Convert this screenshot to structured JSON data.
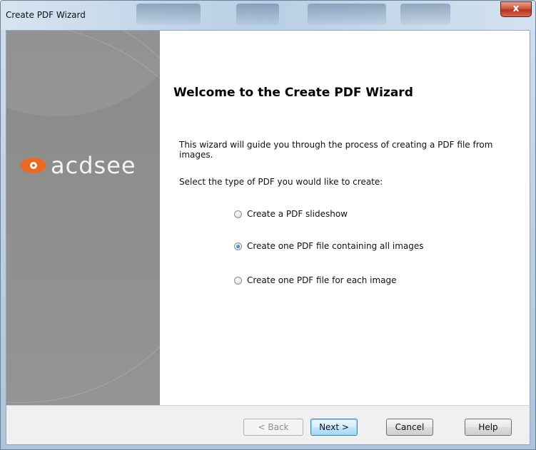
{
  "window": {
    "title": "Create PDF Wizard",
    "close_label": "x"
  },
  "logo": {
    "text": "acdsee"
  },
  "content": {
    "heading": "Welcome to the Create PDF Wizard",
    "description": "This wizard will guide you through the process of creating a PDF file from images.",
    "prompt": "Select the type of PDF you would like to create:"
  },
  "options": [
    {
      "label": "Create a PDF slideshow",
      "checked": false
    },
    {
      "label": "Create one PDF file containing all images",
      "checked": true
    },
    {
      "label": "Create one PDF file for each image",
      "checked": false
    }
  ],
  "buttons": {
    "back": "< Back",
    "next": "Next >",
    "cancel": "Cancel",
    "help": "Help"
  },
  "colors": {
    "accent": "#ea6a22",
    "side_panel": "#8e8e8e",
    "close_button": "#c8442a"
  }
}
